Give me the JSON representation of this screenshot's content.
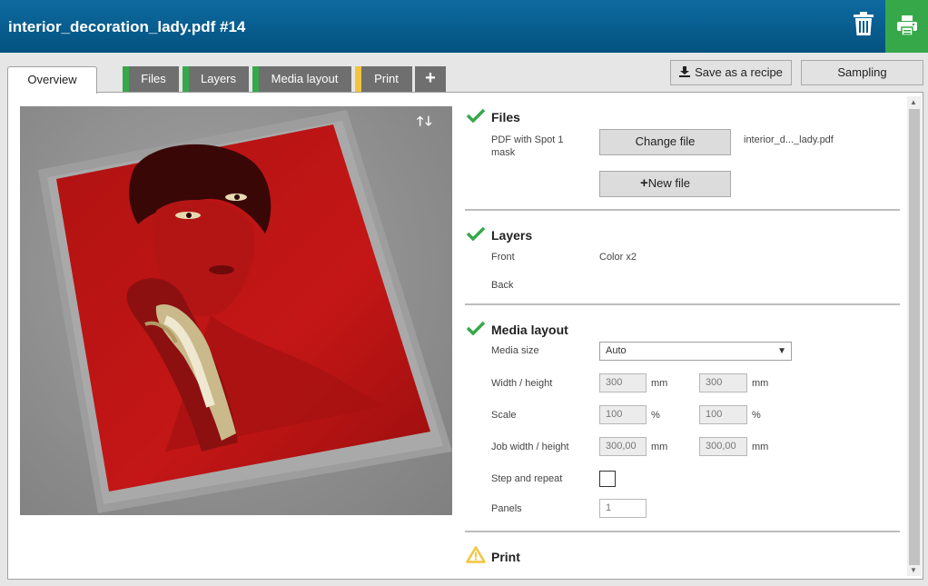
{
  "header": {
    "title": "interior_decoration_lady.pdf #14",
    "colors": {
      "bar": "#03527f",
      "print_button": "#37a84a"
    }
  },
  "tabs": [
    {
      "label": "Overview",
      "status_color": null
    },
    {
      "label": "Files",
      "status_color": "#37a84a"
    },
    {
      "label": "Layers",
      "status_color": "#37a84a"
    },
    {
      "label": "Media layout",
      "status_color": "#37a84a"
    },
    {
      "label": "Print",
      "status_color": "#f2c53d"
    }
  ],
  "tab_add_icon": "plus-icon",
  "toolbar": {
    "save_recipe": "Save as a recipe",
    "sampling": "Sampling"
  },
  "files": {
    "title": "Files",
    "pdf_label": "PDF with Spot 1 mask",
    "change_file": "Change file",
    "file_name": "interior_d..._lady.pdf",
    "new_file": "New file"
  },
  "layers": {
    "title": "Layers",
    "front_label": "Front",
    "front_value": "Color x2",
    "back_label": "Back"
  },
  "media": {
    "title": "Media layout",
    "media_size_label": "Media size",
    "media_size_value": "Auto",
    "wh_label": "Width / height",
    "width": "300",
    "height": "300",
    "unit_mm": "mm",
    "scale_label": "Scale",
    "scale_x": "100",
    "scale_y": "100",
    "unit_pct": "%",
    "job_wh_label": "Job width / height",
    "job_width": "300,00",
    "job_height": "300,00",
    "step_repeat_label": "Step and repeat",
    "panels_label": "Panels",
    "panels_value": "1"
  },
  "print": {
    "title": "Print",
    "status": "warning"
  }
}
